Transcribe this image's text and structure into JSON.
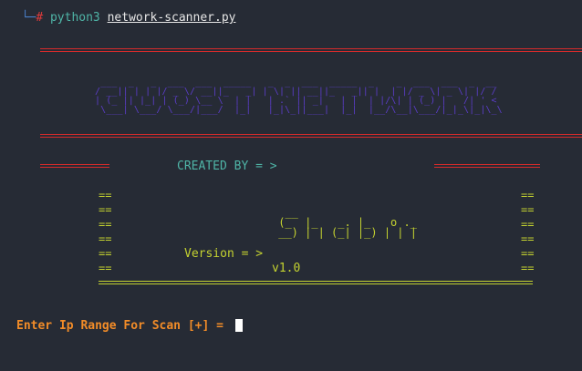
{
  "terminal": {
    "prompt_prefix": "└─",
    "prompt_symbol": "#",
    "command": "python3",
    "argument": "network-scanner.py"
  },
  "banner": {
    "title_art": " ___  _   _  ___  ___  _____   _  _  ___  _____  _    _  ___  ___  _  __\n/ __|| | | |/ _ \\/ __||_   _| | \\| || __||_   _|| |  | |/ _ \\| _ \\| |/ /\n| (_ || |_| | (_) \\__ \\  | |   | .` || _|   | |  | |/\\| | (_) |   /| ' < \n \\___| \\___/ \\___/|___/  |_|   |_|\\_||___|  |_|  |__/\\__|\\___/|_|_\\|_|\\_\\",
    "created_by_label": "CREATED BY = >",
    "author_art": "  __\n (_  |_   _. |_   o ._\n __) | | (_| |_) | | |",
    "version_label": "Version = >",
    "version_value": "v1.0",
    "eq_glyph": "=="
  },
  "input": {
    "prompt": "Enter Ip Range For Scan [+] = "
  },
  "colors": {
    "background": "#262b35",
    "red": "#d52b2b",
    "purple": "#5b3dc8",
    "teal": "#4fb5a7",
    "yellow": "#c4d230",
    "orange": "#f28c28",
    "text": "#d6d6d6"
  }
}
